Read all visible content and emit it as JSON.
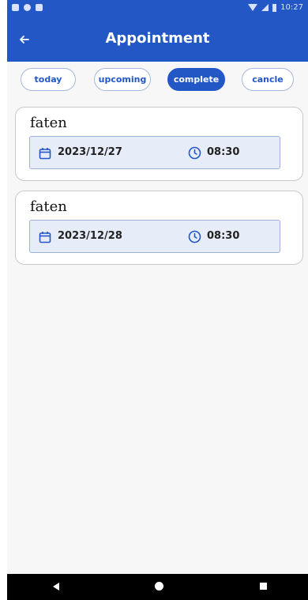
{
  "status_bar": {
    "time": "10:27"
  },
  "app_bar": {
    "title": "Appointment",
    "back_icon": "arrow-left-icon"
  },
  "tabs": [
    {
      "label": "today",
      "active": false
    },
    {
      "label": "upcoming",
      "active": false
    },
    {
      "label": "complete",
      "active": true
    },
    {
      "label": "cancle",
      "active": false
    }
  ],
  "appointments": [
    {
      "name": "faten",
      "date": "2023/12/27",
      "time": "08:30"
    },
    {
      "name": "faten",
      "date": "2023/12/28",
      "time": "08:30"
    }
  ],
  "colors": {
    "primary": "#2357c6",
    "card_info_bg": "#e6ecf8",
    "background": "#f7f7f7"
  }
}
